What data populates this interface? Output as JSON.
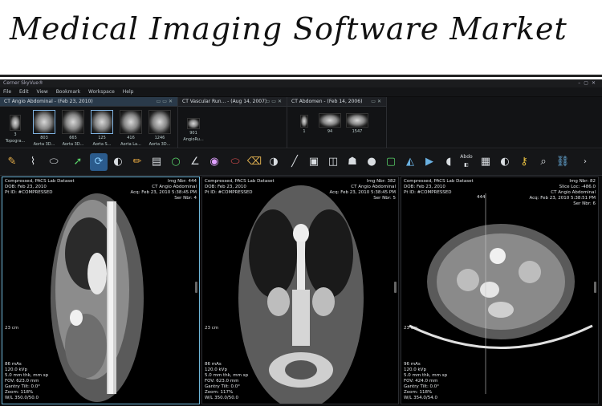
{
  "banner": {
    "title": "Medical Imaging Software Market"
  },
  "app": {
    "title": "Cerner SkyVue®",
    "menu": [
      "File",
      "Edit",
      "View",
      "Bookmark",
      "Workspace",
      "Help"
    ]
  },
  "studies": [
    {
      "tab": "CT Angio Abdominal - (Feb 23, 2010)",
      "thumbs": [
        {
          "count": "3",
          "label": "Topogra..."
        },
        {
          "count": "803",
          "label": "Aorta 3D..."
        },
        {
          "count": "665",
          "label": "Aorta 3D..."
        },
        {
          "count": "125",
          "label": "Aorta S..."
        },
        {
          "count": "416",
          "label": "Aorta La..."
        },
        {
          "count": "1246",
          "label": "Aorta 3D..."
        },
        {
          "count": "901",
          "label": "AngioRu..."
        }
      ]
    },
    {
      "tab": "CT Vascular Run... - (Aug 14, 2007)",
      "thumbs": [
        {
          "count": "1",
          "label": ""
        },
        {
          "count": "94",
          "label": ""
        }
      ]
    },
    {
      "tab": "CT Abdomen - (Feb 14, 2006)",
      "thumbs": [
        {
          "count": "1547",
          "label": ""
        }
      ]
    }
  ],
  "viewports": [
    {
      "tl": "Compressed, PACS Lab Dataset\nDOB: Feb 23, 2010\nPt ID: #COMPRESSED",
      "tr": "Img Nbr: 444\nCT Angio Abdominal\nAcq: Feb 23, 2010 5:38:45 PM\nSer Nbr: 4",
      "bl": "86 mAs\n120.0 kVp\n5.0 mm thk, mm sp\nFOV: 623.0 mm\nGantry Tilt: 0.0°\nZoom: 118%\nW/L 350.0/50.0",
      "scale": "23 cm"
    },
    {
      "tl": "Compressed, PACS Lab Dataset\nDOB: Feb 23, 2010\nPt ID: #COMPRESSED",
      "tr": "Img Nbr: 382\nCT Angio Abdominal\nAcq: Feb 23, 2010 5:38:45 PM\nSer Nbr: 5",
      "bl": "86 mAs\n120.0 kVp\n5.0 mm thk, mm sp\nFOV: 623.0 mm\nGantry Tilt: 0.0°\nZoom: 117%\nW/L 350.0/50.0",
      "scale": "23 cm"
    },
    {
      "tl": "Compressed, PACS Lab Dataset\nDOB: Feb 23, 2010\nPt ID: #COMPRESSED",
      "tr": "Img Nbr: 82\nSlice Loc: -486.0\nCT Angio Abdominal\nAcq: Feb 23, 2010 5:38:51 PM\nSer Nbr: 6",
      "bl": "96 mAs\n120.0 kVp\n5.0 mm thk, mm sp\nFOV: 424.0 mm\nGantry Tilt: 0.0°\nZoom: 118%\nW/L 354.0/54.0",
      "scale": "23 cm",
      "crosshair": "444"
    }
  ],
  "toolbar": {
    "abdo_label": "Abdo",
    "icons": [
      "pencil-icon",
      "curve-icon",
      "ellipse-icon",
      "arrow-icon",
      "rotate-icon",
      "window-level-icon",
      "ruler-icon",
      "film-icon",
      "circle-icon",
      "angle-icon",
      "color-wheel-icon",
      "erase-annotation-icon",
      "erase-icon",
      "reset-icon",
      "line-icon",
      "layout-1-icon",
      "layout-2-icon",
      "body-icon",
      "sphere-icon",
      "crop-icon",
      "flip-icon",
      "play-icon",
      "invert-icon",
      "abdo-preset-icon",
      "grid-icon",
      "contrast-icon",
      "key-icon",
      "search-icon",
      "link-icon",
      "more-icon"
    ]
  }
}
